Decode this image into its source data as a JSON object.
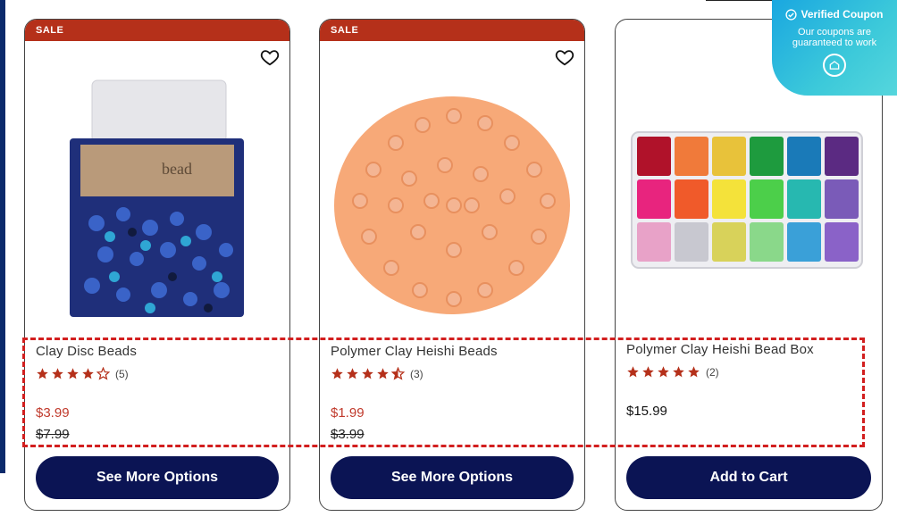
{
  "products": [
    {
      "badge": "SALE",
      "title": "Clay Disc Beads",
      "rating": 4,
      "rating_count": "(5)",
      "price_sale": "$3.99",
      "price_original": "$7.99",
      "cta": "See More Options"
    },
    {
      "badge": "SALE",
      "title": "Polymer Clay Heishi Beads",
      "rating": 4.5,
      "rating_count": "(3)",
      "price_sale": "$1.99",
      "price_original": "$3.99",
      "cta": "See More Options"
    },
    {
      "title": "Polymer Clay Heishi Bead Box",
      "rating": 5,
      "rating_count": "(2)",
      "price": "$15.99",
      "cta": "Add to Cart"
    }
  ],
  "coupon": {
    "title": "Verified Coupon",
    "subtitle": "Our coupons are guaranteed to work"
  },
  "colors": {
    "sale_banner": "#b5301a",
    "star": "#b5301a",
    "cta_background": "#0b1454",
    "sale_price": "#c0392b",
    "highlight_border": "#d21f1f"
  },
  "icons": [
    "heart-icon",
    "star-icon",
    "check-circle-icon",
    "coupon-logo-icon"
  ]
}
